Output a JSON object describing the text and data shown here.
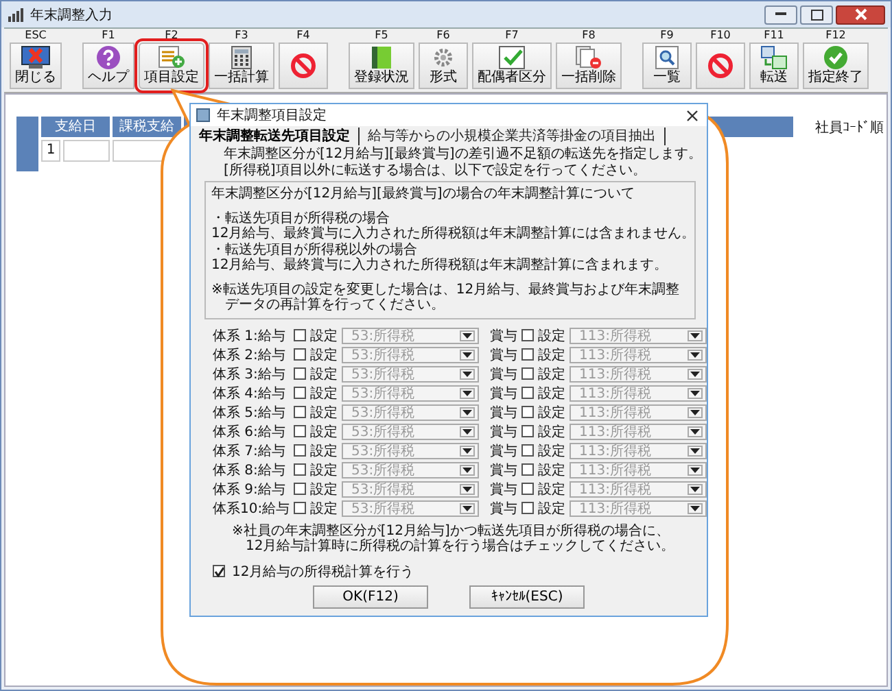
{
  "window": {
    "title": "年末調整入力"
  },
  "toolbar": [
    {
      "key": "ESC",
      "label": "閉じる",
      "kind": "close",
      "highlighted": false
    },
    {
      "key": "F1",
      "label": "ヘルプ",
      "kind": "help",
      "highlighted": false
    },
    {
      "key": "F2",
      "label": "項目設定",
      "kind": "list-add",
      "highlighted": true
    },
    {
      "key": "F3",
      "label": "一括計算",
      "kind": "calculator",
      "highlighted": false
    },
    {
      "key": "F4",
      "kind": "prohibited",
      "highlighted": false
    },
    {
      "key": "F5",
      "label": "登録状況",
      "kind": "binder",
      "highlighted": false
    },
    {
      "key": "F6",
      "label": "形式",
      "kind": "gear",
      "highlighted": false
    },
    {
      "key": "F7",
      "label": "配偶者区分",
      "kind": "checklist",
      "highlighted": false
    },
    {
      "key": "F8",
      "label": "一括削除",
      "kind": "delete-docs",
      "highlighted": false
    },
    {
      "key": "F9",
      "label": "一覧",
      "kind": "magnifier",
      "highlighted": false
    },
    {
      "key": "F10",
      "kind": "prohibited",
      "highlighted": false
    },
    {
      "key": "F11",
      "label": "転送",
      "kind": "transfer",
      "highlighted": false
    },
    {
      "key": "F12",
      "label": "指定終了",
      "kind": "check",
      "highlighted": false
    }
  ],
  "table": {
    "columns": [
      "支給日",
      "課税支給"
    ],
    "rows": [
      [
        "1"
      ]
    ]
  },
  "sort_label": "社員ｺｰﾄﾞ順",
  "dialog": {
    "title": "年末調整項目設定",
    "tabs": [
      {
        "label": "年末調整転送先項目設定",
        "selected": true
      },
      {
        "label": "給与等からの小規模企業共済等掛金の項目抽出",
        "selected": false
      }
    ],
    "intro": [
      "年末調整区分が[12月給与][最終賞与]の差引過不足額の転送先を指定します。",
      "[所得税]項目以外に転送する場合は、以下で設定を行ってください。"
    ],
    "info": [
      [
        "年末調整区分が[12月給与][最終賞与]の場合の年末調整計算について"
      ],
      [
        "・転送先項目が所得税の場合",
        "12月給与、最終賞与に入力された所得税額は年末調整計算には含まれません。",
        "・転送先項目が所得税以外の場合",
        "12月給与、最終賞与に入力された所得税額は年末調整計算に含まれます。"
      ],
      [
        "※転送先項目の設定を変更した場合は、12月給与、最終賞与および年末調整",
        "　データの再計算を行ってください。"
      ]
    ],
    "rows": [
      {
        "label": "体系 1:給与",
        "salary": {
          "checked": false,
          "setting": "設定",
          "value": "53:所得税",
          "disabled": true
        },
        "bonus_label": "賞与",
        "bonus": {
          "checked": false,
          "setting": "設定",
          "value": "113:所得税",
          "disabled": true
        }
      },
      {
        "label": "体系 2:給与",
        "salary": {
          "checked": false,
          "setting": "設定",
          "value": "53:所得税",
          "disabled": true
        },
        "bonus_label": "賞与",
        "bonus": {
          "checked": false,
          "setting": "設定",
          "value": "113:所得税",
          "disabled": true
        }
      },
      {
        "label": "体系 3:給与",
        "salary": {
          "checked": false,
          "setting": "設定",
          "value": "53:所得税",
          "disabled": true
        },
        "bonus_label": "賞与",
        "bonus": {
          "checked": false,
          "setting": "設定",
          "value": "113:所得税",
          "disabled": true
        }
      },
      {
        "label": "体系 4:給与",
        "salary": {
          "checked": false,
          "setting": "設定",
          "value": "53:所得税",
          "disabled": true
        },
        "bonus_label": "賞与",
        "bonus": {
          "checked": false,
          "setting": "設定",
          "value": "113:所得税",
          "disabled": true
        }
      },
      {
        "label": "体系 5:給与",
        "salary": {
          "checked": false,
          "setting": "設定",
          "value": "53:所得税",
          "disabled": true
        },
        "bonus_label": "賞与",
        "bonus": {
          "checked": false,
          "setting": "設定",
          "value": "113:所得税",
          "disabled": true
        }
      },
      {
        "label": "体系 6:給与",
        "salary": {
          "checked": false,
          "setting": "設定",
          "value": "53:所得税",
          "disabled": true
        },
        "bonus_label": "賞与",
        "bonus": {
          "checked": false,
          "setting": "設定",
          "value": "113:所得税",
          "disabled": true
        }
      },
      {
        "label": "体系 7:給与",
        "salary": {
          "checked": false,
          "setting": "設定",
          "value": "53:所得税",
          "disabled": true
        },
        "bonus_label": "賞与",
        "bonus": {
          "checked": false,
          "setting": "設定",
          "value": "113:所得税",
          "disabled": true
        }
      },
      {
        "label": "体系 8:給与",
        "salary": {
          "checked": false,
          "setting": "設定",
          "value": "53:所得税",
          "disabled": true
        },
        "bonus_label": "賞与",
        "bonus": {
          "checked": false,
          "setting": "設定",
          "value": "113:所得税",
          "disabled": true
        }
      },
      {
        "label": "体系 9:給与",
        "salary": {
          "checked": false,
          "setting": "設定",
          "value": "53:所得税",
          "disabled": true
        },
        "bonus_label": "賞与",
        "bonus": {
          "checked": false,
          "setting": "設定",
          "value": "113:所得税",
          "disabled": true
        }
      },
      {
        "label": "体系10:給与",
        "salary": {
          "checked": false,
          "setting": "設定",
          "value": "53:所得税",
          "disabled": true
        },
        "bonus_label": "賞与",
        "bonus": {
          "checked": false,
          "setting": "設定",
          "value": "113:所得税",
          "disabled": true
        }
      }
    ],
    "note": [
      "※社員の年末調整区分が[12月給与]かつ転送先項目が所得税の場合に、",
      "　12月給与計算時に所得税の計算を行う場合はチェックしてください。"
    ],
    "option": {
      "label": "12月給与の所得税計算を行う",
      "checked": true
    },
    "buttons": [
      "OK(F12)",
      "ｷｬﾝｾﾙ(ESC)"
    ]
  }
}
